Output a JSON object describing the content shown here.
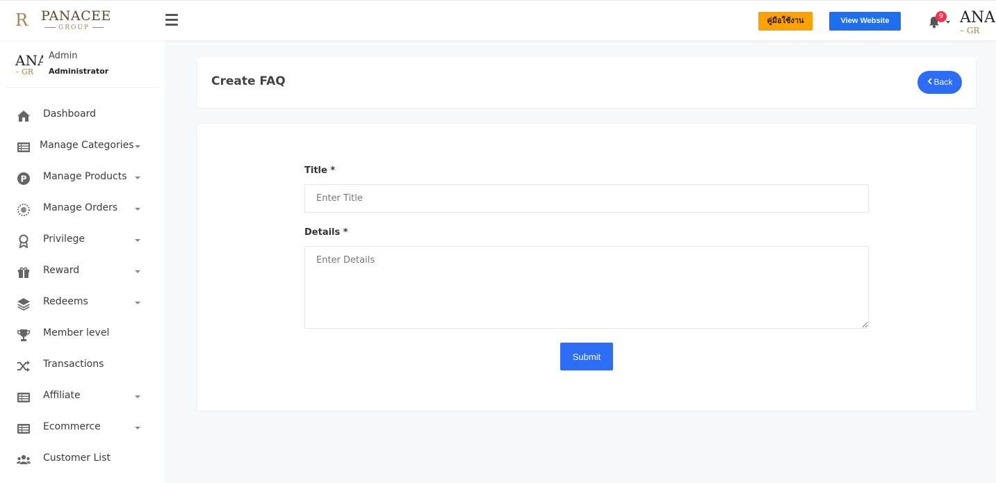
{
  "header": {
    "logo": {
      "mark": "R",
      "name": "PANACEE",
      "sub": "GROUP"
    },
    "manual_button": "คู่มือใช้งาน",
    "view_website_button": "View Website",
    "notification_count": "9",
    "avatar_text": {
      "line1": "ANA",
      "line2": "– GR"
    },
    "colors": {
      "manual": "#ffa200",
      "view": "#1e6ff0",
      "badge": "#f0344e"
    }
  },
  "sidebar": {
    "profile": {
      "avatar_line1": "ANA",
      "avatar_line2": "– GR",
      "name": "Admin",
      "role": "Administrator"
    },
    "items": [
      {
        "label": "Dashboard",
        "icon": "home-icon",
        "has_caret": false
      },
      {
        "label": "Manage Categories",
        "icon": "list-icon",
        "has_caret": true
      },
      {
        "label": "Manage Products",
        "icon": "product-p-icon",
        "has_caret": true
      },
      {
        "label": "Manage Orders",
        "icon": "orders-icon",
        "has_caret": true
      },
      {
        "label": "Privilege",
        "icon": "award-icon",
        "has_caret": true
      },
      {
        "label": "Reward",
        "icon": "gift-icon",
        "has_caret": true
      },
      {
        "label": "Redeems",
        "icon": "layers-icon",
        "has_caret": true
      },
      {
        "label": "Member level",
        "icon": "trophy-icon",
        "has_caret": false
      },
      {
        "label": "Transactions",
        "icon": "shuffle-icon",
        "has_caret": false
      },
      {
        "label": "Affiliate",
        "icon": "table-icon",
        "has_caret": true
      },
      {
        "label": "Ecommerce",
        "icon": "table-icon",
        "has_caret": true
      },
      {
        "label": "Customer List",
        "icon": "users-icon",
        "has_caret": false
      }
    ]
  },
  "page": {
    "title": "Create FAQ",
    "back_button": "Back",
    "form": {
      "title_label": "Title *",
      "title_placeholder": "Enter Title",
      "title_value": "",
      "details_label": "Details *",
      "details_placeholder": "Enter Details",
      "details_value": "",
      "submit_button": "Submit"
    },
    "colors": {
      "primary": "#2d6df6"
    }
  }
}
